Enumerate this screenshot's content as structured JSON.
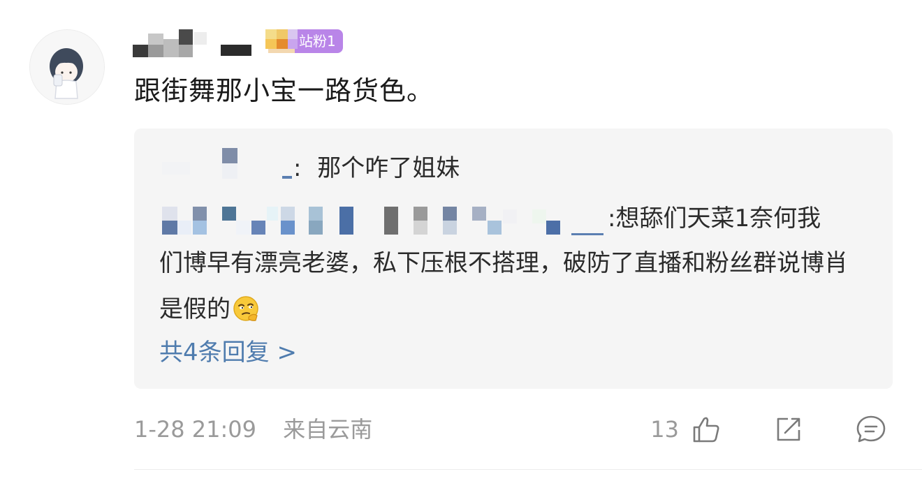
{
  "comment": {
    "badge_label": "站粉1",
    "text": "跟街舞那小宝一路货色。",
    "timestamp": "1-28 21:09",
    "location": "来自云南",
    "like_count": "13"
  },
  "replies": {
    "reply1": {
      "separator": ":",
      "text": "那个咋了姐妹"
    },
    "reply2": {
      "text_first_line": ":想舔们天菜1奈何我",
      "text_rest": "们博早有漂亮老婆，私下压根不搭理，破防了直播和粉丝群说博肖是假的"
    },
    "more_label": "共4条回复 >"
  },
  "icons": {
    "like": "thumbs-up-icon",
    "share": "share-icon",
    "reply": "comment-icon",
    "emoji": "thinking-face-emoji"
  },
  "colors": {
    "badge": "#b985e8",
    "link": "#4f7cae",
    "meta": "#9a9a9a",
    "reply_bg": "#f5f5f5"
  }
}
